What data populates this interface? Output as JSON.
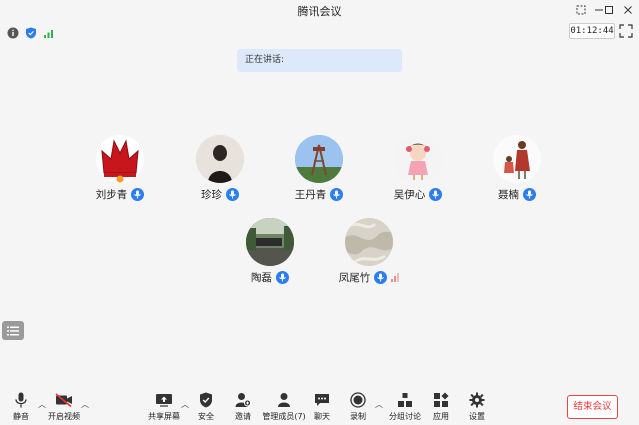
{
  "window": {
    "title": "腾讯会议"
  },
  "status": {
    "timer": "01:12:44"
  },
  "speaking": {
    "label": "正在讲话:"
  },
  "participants": [
    {
      "name": "刘步青",
      "avatar": "red-crown-icon",
      "mic": "mic-on"
    },
    {
      "name": "珍珍",
      "avatar": "person-photo",
      "mic": "mic-on"
    },
    {
      "name": "王丹青",
      "avatar": "tower-photo",
      "mic": "mic-on"
    },
    {
      "name": "吴伊心",
      "avatar": "cartoon-girl",
      "mic": "mic-on"
    },
    {
      "name": "聂楠",
      "avatar": "cartoon-mother-child",
      "mic": "mic-on"
    },
    {
      "name": "陶磊",
      "avatar": "street-photo",
      "mic": "mic-on"
    },
    {
      "name": "凤尾竹",
      "avatar": "fabric-photo",
      "mic": "mic-on"
    }
  ],
  "toolbar": {
    "mute": "静音",
    "video": "开启视频",
    "share": "共享屏幕",
    "security": "安全",
    "invite": "邀请",
    "members": "管理成员(7)",
    "chat": "聊天",
    "record": "录制",
    "breakout": "分组讨论",
    "apps": "应用",
    "settings": "设置",
    "end": "结束会议"
  },
  "colors": {
    "accent": "#2b7ef0",
    "danger": "#e33333",
    "speaking_bg": "#dde9fb"
  }
}
